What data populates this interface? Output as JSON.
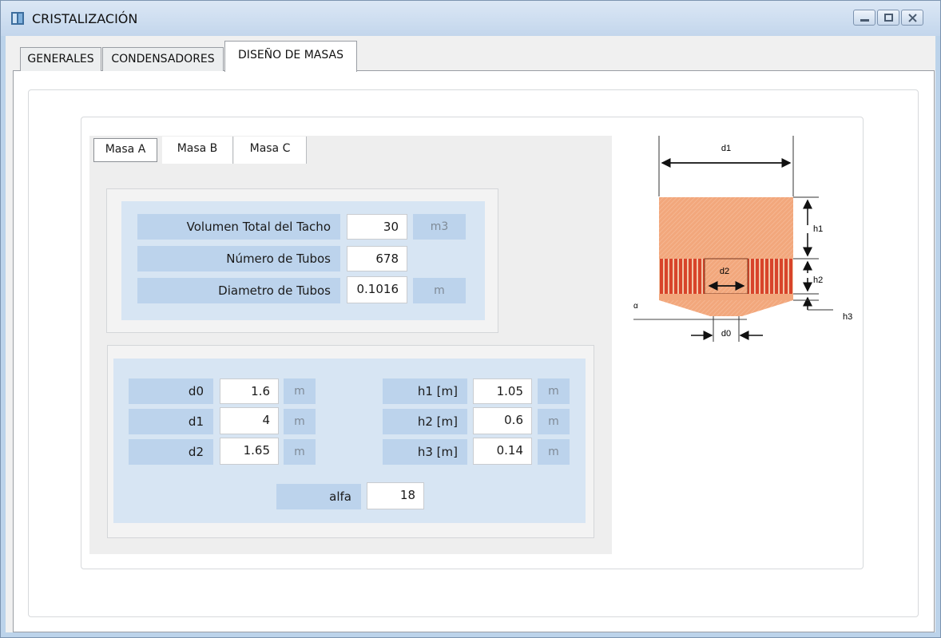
{
  "window": {
    "title": "CRISTALIZACIÓN"
  },
  "tabs": [
    "GENERALES",
    "CONDENSADORES",
    "DISEÑO DE MASAS"
  ],
  "subtabs": [
    "Masa A",
    "Masa B",
    "Masa C"
  ],
  "general_fields": [
    {
      "label": "Volumen Total del Tacho",
      "value": "30",
      "unit": "m3"
    },
    {
      "label": "Número de Tubos",
      "value": "678",
      "unit": ""
    },
    {
      "label": "Diametro de Tubos",
      "value": "0.1016",
      "unit": "m"
    }
  ],
  "dimensions_left": [
    {
      "label": "d0",
      "value": "1.6",
      "unit": "m"
    },
    {
      "label": "d1",
      "value": "4",
      "unit": "m"
    },
    {
      "label": "d2",
      "value": "1.65",
      "unit": "m"
    }
  ],
  "dimensions_right": [
    {
      "label": "h1 [m]",
      "value": "1.05",
      "unit": "m"
    },
    {
      "label": "h2 [m]",
      "value": "0.6",
      "unit": "m"
    },
    {
      "label": "h3 [m]",
      "value": "0.14",
      "unit": "m"
    }
  ],
  "alpha": {
    "label": "alfa",
    "value": "18"
  },
  "diagram": {
    "labels": {
      "d1": "d1",
      "h1": "h1",
      "h2": "h2",
      "h3": "h3",
      "d2": "d2",
      "d0": "d0",
      "alpha": "α"
    },
    "colors": {
      "body": "#f2a77c",
      "tubes": "#d8442a",
      "stripe": "#ffffff"
    }
  },
  "colors": {
    "label_bg": "#bcd3ec",
    "group_bg": "#d7e5f3",
    "titlebar": "#c3d6ec"
  }
}
